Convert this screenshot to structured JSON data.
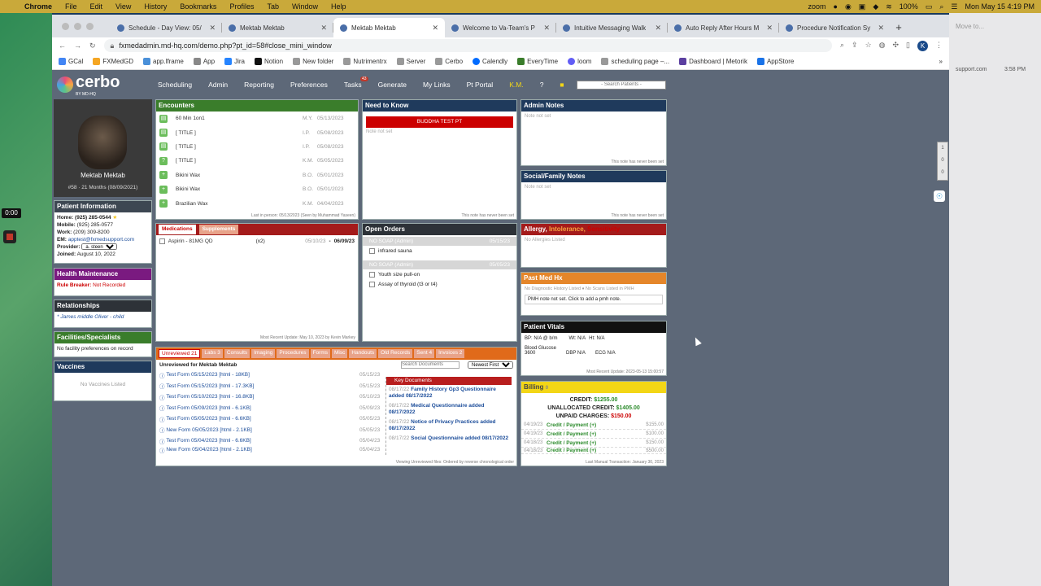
{
  "menubar": {
    "apple": "",
    "app": "Chrome",
    "items": [
      "File",
      "Edit",
      "View",
      "History",
      "Bookmarks",
      "Profiles",
      "Tab",
      "Window",
      "Help"
    ],
    "zoom": "zoom",
    "battery": "100%",
    "datetime": "Mon May 15  4:19 PM"
  },
  "tabs": [
    {
      "label": "Schedule - Day View: 05/",
      "active": false
    },
    {
      "label": "Mektab Mektab",
      "active": false
    },
    {
      "label": "Mektab Mektab",
      "active": true
    },
    {
      "label": "Welcome to Va-Team's P",
      "active": false
    },
    {
      "label": "Intuitive Messaging Walk",
      "active": false
    },
    {
      "label": "Auto Reply After Hours M",
      "active": false
    },
    {
      "label": "Procedure Notification Sy",
      "active": false
    }
  ],
  "omnibox": {
    "url": "fxmedadmin.md-hq.com/demo.php?pt_id=58#close_mini_window"
  },
  "profile_initial": "K",
  "bookmarks": [
    "GCal",
    "FXMedGD",
    "app.lframe",
    "App",
    "Jira",
    "Notion",
    "New folder",
    "Nutrimentrx",
    "Server",
    "Cerbo",
    "Calendly",
    "EveryTime",
    "loom",
    "scheduling page –...",
    "Dashboard | Metorik",
    "AppStore"
  ],
  "right_window": {
    "title": "Move to...",
    "url": "support.com",
    "time": "3:58 PM"
  },
  "recording": {
    "timer": "0:00"
  },
  "nav": {
    "logo": "cerbo",
    "logo_sub": "BY MD-HQ",
    "items": [
      "Scheduling",
      "Admin",
      "Reporting",
      "Preferences",
      "Tasks",
      "Generate",
      "My Links",
      "Pt Portal",
      "K.M."
    ],
    "tasks_badge": "43",
    "search_placeholder": "- Search Patients -"
  },
  "patient": {
    "name": "Mektab Mektab",
    "id_age": "#58 · 21 Months (08/09/2021)",
    "home": "(925) 285-0544",
    "mobile": "(925) 285-0577",
    "work": "(209) 309-8200",
    "email": "apptest@fxmedsupport.com",
    "provider": "a. steen",
    "joined": "August 10, 2022",
    "labels": {
      "home": "Home:",
      "mobile": "Mobile:",
      "work": "Work:",
      "email": "EM:",
      "provider": "Provider:",
      "joined": "Joined:"
    }
  },
  "left": {
    "patient_info": "Patient Information",
    "health_maint": "Health Maintenance",
    "rule_breaker": "Rule Breaker:",
    "not_recorded": "Not Recorded",
    "relationships": "Relationships",
    "relationship": "* James middle Oliver - child",
    "facilities": "Facilities/Specialists",
    "no_facility": "No facility preferences on record",
    "vaccines": "Vaccines",
    "no_vaccines": "No Vaccines Listed"
  },
  "encounters": {
    "title": "Encounters",
    "rows": [
      {
        "name": "60 Min 1on1",
        "init": "M.Y.",
        "date": "05/13/2023"
      },
      {
        "name": "[ TITLE ]",
        "init": "I.P.",
        "date": "05/08/2023"
      },
      {
        "name": "[ TITLE ]",
        "init": "I.P.",
        "date": "05/08/2023"
      },
      {
        "name": "[ TITLE ]",
        "init": "K.M.",
        "date": "05/05/2023"
      },
      {
        "name": "Bikini Wax",
        "init": "B.O.",
        "date": "05/01/2023"
      },
      {
        "name": "Bikini Wax",
        "init": "B.O.",
        "date": "05/01/2023"
      },
      {
        "name": "Brazilian Wax",
        "init": "K.M.",
        "date": "04/04/2023"
      }
    ],
    "footer": "Last in person: 05/13/2023 (Seen by Muhammad Yaseen)"
  },
  "need_to_know": {
    "title": "Need to Know",
    "banner": "BUDDHA TEST PT",
    "note": "Note not set",
    "footer": "This note has never been set"
  },
  "admin_notes": {
    "title": "Admin Notes",
    "note": "Note not set",
    "footer": "This note has never been set"
  },
  "social_notes": {
    "title": "Social/Family Notes",
    "note": "Note not set",
    "footer": "This note has never been set"
  },
  "medications": {
    "tab1": "Medications",
    "tab2": "Supplements",
    "items": [
      {
        "name": "Aspirin - 81MG QD",
        "qty": "(x2)",
        "date1": "05/10/23",
        "date2": "06/09/23"
      }
    ],
    "footer": "Most Recent Update: May 10, 2023 by Kevin Markey"
  },
  "orders": {
    "title": "Open Orders",
    "groups": [
      {
        "header": "NO SOAP (Admin)",
        "date": "05/15/23",
        "items": [
          "infrared sauna"
        ]
      },
      {
        "header": "NO SOAP (Admin)",
        "date": "05/05/23",
        "items": [
          "Youth size pull-on",
          "Assay of thyroid (t3 or t4)"
        ]
      }
    ]
  },
  "allergy": {
    "title1": "Allergy,",
    "title2": "Intolerance,",
    "title3": "Sensitivity",
    "none": "No Allergies Listed"
  },
  "past_med": {
    "title": "Past Med Hx",
    "line": "No Diagnostic History Listed  ♦  No Scans Listed in PMH",
    "pmh": "PMH note not set. Click to add a pmh note."
  },
  "vitals": {
    "title": "Patient Vitals",
    "bp": "BP: N/A @ b/m",
    "wt": "Wt: N/A",
    "ht": "Ht: N/A",
    "bg_label": "Blood Glucose",
    "bg_val": "3600",
    "dbp": "DBP N/A",
    "ecg": "ECG N/A",
    "footer": "Most Recent Update: 2023-05-13 15:00:57"
  },
  "billing": {
    "title": "Billing",
    "count": "0",
    "credit_label": "CREDIT:",
    "credit": "$1255.00",
    "unalloc_label": "UNALLOCATED CREDIT:",
    "unalloc": "$1405.00",
    "unpaid_label": "UNPAID CHARGES:",
    "unpaid": "$150.00",
    "rows": [
      {
        "date": "04/19/23",
        "label": "Credit / Payment (+)",
        "amt": "$155.00"
      },
      {
        "date": "04/19/23",
        "label": "Credit / Payment (+)",
        "amt": "$100.00"
      },
      {
        "date": "04/18/23",
        "label": "Credit / Payment (+)",
        "amt": "$150.00"
      },
      {
        "date": "04/18/23",
        "label": "Credit / Payment (+)",
        "amt": "$500.00"
      }
    ],
    "footer": "Last Manual Transaction: January 30, 2023"
  },
  "docs": {
    "tabs": [
      "Unreviewed 21",
      "Labs 3",
      "Consults",
      "Imaging",
      "Procedures",
      "Forms",
      "Misc",
      "Handouts",
      "Old Records",
      "Sent 4",
      "Invoices 2"
    ],
    "header": "Unreviewed for Mektab Mektab",
    "search_placeholder": "Search Documents",
    "sort": "Newest First",
    "rows": [
      {
        "name": "Test Form 05/15/2023 [html - 18KB]",
        "date": "05/15/23"
      },
      {
        "name": "Test Form 05/15/2023 [html - 17.3KB]",
        "date": "05/15/23"
      },
      {
        "name": "Test Form 05/10/2023 [html - 16.8KB]",
        "date": "05/10/23"
      },
      {
        "name": "Test Form 05/09/2023 [html - 6.1KB]",
        "date": "05/09/23"
      },
      {
        "name": "Test Form 05/05/2023 [html - 6.6KB]",
        "date": "05/05/23"
      },
      {
        "name": "New Form 05/05/2023 [html - 2.1KB]",
        "date": "05/05/23"
      },
      {
        "name": "Test Form 05/04/2023 [html - 6.6KB]",
        "date": "05/04/23"
      },
      {
        "name": "New Form 05/04/2023 [html - 2.1KB]",
        "date": "05/04/23"
      }
    ],
    "key_header": "Key Documents",
    "key": [
      {
        "d": "08/17/22",
        "t": "Family History Gp3 Questionnaire added 08/17/2022"
      },
      {
        "d": "08/17/22",
        "t": "Medical Questionnaire added 08/17/2022"
      },
      {
        "d": "08/17/22",
        "t": "Notice of Privacy Practices added 08/17/2022"
      },
      {
        "d": "08/17/22",
        "t": "Social Questionnaire added 08/17/2022"
      }
    ],
    "footer": "Viewing Unreviewed files: Ordered by reverse chronological order"
  },
  "side_right": [
    "1",
    "0",
    "0"
  ]
}
